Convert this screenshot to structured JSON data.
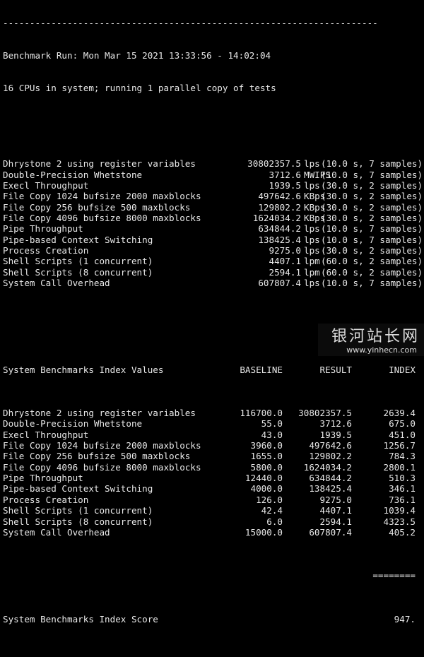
{
  "header": {
    "rule": "----------------------------------------------------------------------",
    "run_line": "Benchmark Run: Mon Mar 15 2021 13:33:56 - 14:02:04",
    "cpu_line": "16 CPUs in system; running 1 parallel copy of tests"
  },
  "results": [
    {
      "name": "Dhrystone 2 using register variables",
      "value": "30802357.5",
      "unit": "lps",
      "timing": "(10.0 s, 7 samples)"
    },
    {
      "name": "Double-Precision Whetstone",
      "value": "3712.6",
      "unit": "MWIPS",
      "timing": "(10.0 s, 7 samples)"
    },
    {
      "name": "Execl Throughput",
      "value": "1939.5",
      "unit": "lps",
      "timing": "(30.0 s, 2 samples)"
    },
    {
      "name": "File Copy 1024 bufsize 2000 maxblocks",
      "value": "497642.6",
      "unit": "KBps",
      "timing": "(30.0 s, 2 samples)"
    },
    {
      "name": "File Copy 256 bufsize 500 maxblocks",
      "value": "129802.2",
      "unit": "KBps",
      "timing": "(30.0 s, 2 samples)"
    },
    {
      "name": "File Copy 4096 bufsize 8000 maxblocks",
      "value": "1624034.2",
      "unit": "KBps",
      "timing": "(30.0 s, 2 samples)"
    },
    {
      "name": "Pipe Throughput",
      "value": "634844.2",
      "unit": "lps",
      "timing": "(10.0 s, 7 samples)"
    },
    {
      "name": "Pipe-based Context Switching",
      "value": "138425.4",
      "unit": "lps",
      "timing": "(10.0 s, 7 samples)"
    },
    {
      "name": "Process Creation",
      "value": "9275.0",
      "unit": "lps",
      "timing": "(30.0 s, 2 samples)"
    },
    {
      "name": "Shell Scripts (1 concurrent)",
      "value": "4407.1",
      "unit": "lpm",
      "timing": "(60.0 s, 2 samples)"
    },
    {
      "name": "Shell Scripts (8 concurrent)",
      "value": "2594.1",
      "unit": "lpm",
      "timing": "(60.0 s, 2 samples)"
    },
    {
      "name": "System Call Overhead",
      "value": "607807.4",
      "unit": "lps",
      "timing": "(10.0 s, 7 samples)"
    }
  ],
  "index_table": {
    "title": "System Benchmarks Index Values",
    "col_baseline": "BASELINE",
    "col_result": "RESULT",
    "col_index": "INDEX",
    "rows": [
      {
        "name": "Dhrystone 2 using register variables",
        "baseline": "116700.0",
        "result": "30802357.5",
        "index": "2639.4"
      },
      {
        "name": "Double-Precision Whetstone",
        "baseline": "55.0",
        "result": "3712.6",
        "index": "675.0"
      },
      {
        "name": "Execl Throughput",
        "baseline": "43.0",
        "result": "1939.5",
        "index": "451.0"
      },
      {
        "name": "File Copy 1024 bufsize 2000 maxblocks",
        "baseline": "3960.0",
        "result": "497642.6",
        "index": "1256.7"
      },
      {
        "name": "File Copy 256 bufsize 500 maxblocks",
        "baseline": "1655.0",
        "result": "129802.2",
        "index": "784.3"
      },
      {
        "name": "File Copy 4096 bufsize 8000 maxblocks",
        "baseline": "5800.0",
        "result": "1624034.2",
        "index": "2800.1"
      },
      {
        "name": "Pipe Throughput",
        "baseline": "12440.0",
        "result": "634844.2",
        "index": "510.3"
      },
      {
        "name": "Pipe-based Context Switching",
        "baseline": "4000.0",
        "result": "138425.4",
        "index": "346.1"
      },
      {
        "name": "Process Creation",
        "baseline": "126.0",
        "result": "9275.0",
        "index": "736.1"
      },
      {
        "name": "Shell Scripts (1 concurrent)",
        "baseline": "42.4",
        "result": "4407.1",
        "index": "1039.4"
      },
      {
        "name": "Shell Scripts (8 concurrent)",
        "baseline": "6.0",
        "result": "2594.1",
        "index": "4323.5"
      },
      {
        "name": "System Call Overhead",
        "baseline": "15000.0",
        "result": "607807.4",
        "index": "405.2"
      }
    ],
    "score_label": "System Benchmarks Index Score",
    "score_value": "947."
  },
  "watermark": {
    "text": "银河站长网",
    "url": "www.yinhecn.com"
  },
  "colors": {
    "background": "#000000",
    "foreground": "#e8e8e8"
  }
}
